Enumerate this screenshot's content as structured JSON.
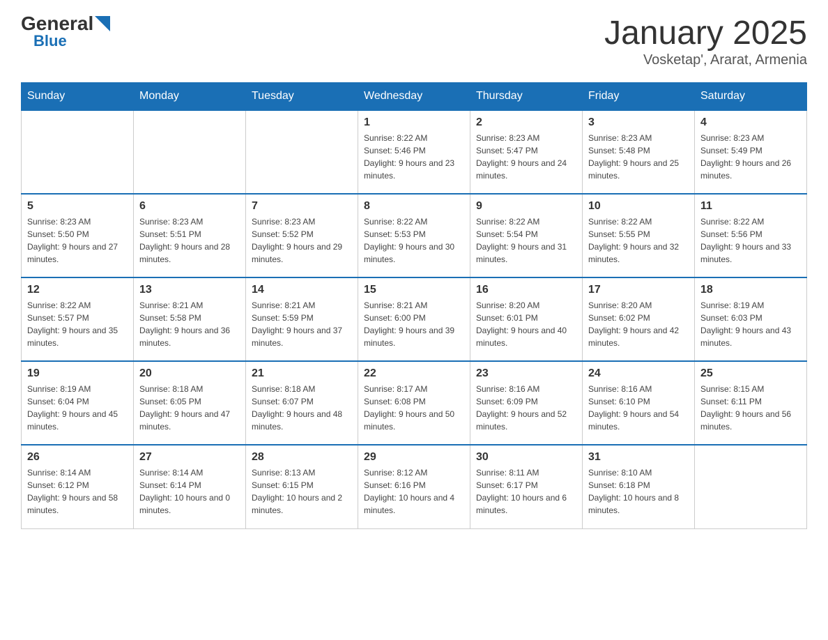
{
  "logo": {
    "general": "General",
    "blue": "Blue"
  },
  "title": "January 2025",
  "subtitle": "Vosketap', Ararat, Armenia",
  "days_of_week": [
    "Sunday",
    "Monday",
    "Tuesday",
    "Wednesday",
    "Thursday",
    "Friday",
    "Saturday"
  ],
  "weeks": [
    [
      {
        "day": "",
        "info": ""
      },
      {
        "day": "",
        "info": ""
      },
      {
        "day": "",
        "info": ""
      },
      {
        "day": "1",
        "info": "Sunrise: 8:22 AM\nSunset: 5:46 PM\nDaylight: 9 hours and 23 minutes."
      },
      {
        "day": "2",
        "info": "Sunrise: 8:23 AM\nSunset: 5:47 PM\nDaylight: 9 hours and 24 minutes."
      },
      {
        "day": "3",
        "info": "Sunrise: 8:23 AM\nSunset: 5:48 PM\nDaylight: 9 hours and 25 minutes."
      },
      {
        "day": "4",
        "info": "Sunrise: 8:23 AM\nSunset: 5:49 PM\nDaylight: 9 hours and 26 minutes."
      }
    ],
    [
      {
        "day": "5",
        "info": "Sunrise: 8:23 AM\nSunset: 5:50 PM\nDaylight: 9 hours and 27 minutes."
      },
      {
        "day": "6",
        "info": "Sunrise: 8:23 AM\nSunset: 5:51 PM\nDaylight: 9 hours and 28 minutes."
      },
      {
        "day": "7",
        "info": "Sunrise: 8:23 AM\nSunset: 5:52 PM\nDaylight: 9 hours and 29 minutes."
      },
      {
        "day": "8",
        "info": "Sunrise: 8:22 AM\nSunset: 5:53 PM\nDaylight: 9 hours and 30 minutes."
      },
      {
        "day": "9",
        "info": "Sunrise: 8:22 AM\nSunset: 5:54 PM\nDaylight: 9 hours and 31 minutes."
      },
      {
        "day": "10",
        "info": "Sunrise: 8:22 AM\nSunset: 5:55 PM\nDaylight: 9 hours and 32 minutes."
      },
      {
        "day": "11",
        "info": "Sunrise: 8:22 AM\nSunset: 5:56 PM\nDaylight: 9 hours and 33 minutes."
      }
    ],
    [
      {
        "day": "12",
        "info": "Sunrise: 8:22 AM\nSunset: 5:57 PM\nDaylight: 9 hours and 35 minutes."
      },
      {
        "day": "13",
        "info": "Sunrise: 8:21 AM\nSunset: 5:58 PM\nDaylight: 9 hours and 36 minutes."
      },
      {
        "day": "14",
        "info": "Sunrise: 8:21 AM\nSunset: 5:59 PM\nDaylight: 9 hours and 37 minutes."
      },
      {
        "day": "15",
        "info": "Sunrise: 8:21 AM\nSunset: 6:00 PM\nDaylight: 9 hours and 39 minutes."
      },
      {
        "day": "16",
        "info": "Sunrise: 8:20 AM\nSunset: 6:01 PM\nDaylight: 9 hours and 40 minutes."
      },
      {
        "day": "17",
        "info": "Sunrise: 8:20 AM\nSunset: 6:02 PM\nDaylight: 9 hours and 42 minutes."
      },
      {
        "day": "18",
        "info": "Sunrise: 8:19 AM\nSunset: 6:03 PM\nDaylight: 9 hours and 43 minutes."
      }
    ],
    [
      {
        "day": "19",
        "info": "Sunrise: 8:19 AM\nSunset: 6:04 PM\nDaylight: 9 hours and 45 minutes."
      },
      {
        "day": "20",
        "info": "Sunrise: 8:18 AM\nSunset: 6:05 PM\nDaylight: 9 hours and 47 minutes."
      },
      {
        "day": "21",
        "info": "Sunrise: 8:18 AM\nSunset: 6:07 PM\nDaylight: 9 hours and 48 minutes."
      },
      {
        "day": "22",
        "info": "Sunrise: 8:17 AM\nSunset: 6:08 PM\nDaylight: 9 hours and 50 minutes."
      },
      {
        "day": "23",
        "info": "Sunrise: 8:16 AM\nSunset: 6:09 PM\nDaylight: 9 hours and 52 minutes."
      },
      {
        "day": "24",
        "info": "Sunrise: 8:16 AM\nSunset: 6:10 PM\nDaylight: 9 hours and 54 minutes."
      },
      {
        "day": "25",
        "info": "Sunrise: 8:15 AM\nSunset: 6:11 PM\nDaylight: 9 hours and 56 minutes."
      }
    ],
    [
      {
        "day": "26",
        "info": "Sunrise: 8:14 AM\nSunset: 6:12 PM\nDaylight: 9 hours and 58 minutes."
      },
      {
        "day": "27",
        "info": "Sunrise: 8:14 AM\nSunset: 6:14 PM\nDaylight: 10 hours and 0 minutes."
      },
      {
        "day": "28",
        "info": "Sunrise: 8:13 AM\nSunset: 6:15 PM\nDaylight: 10 hours and 2 minutes."
      },
      {
        "day": "29",
        "info": "Sunrise: 8:12 AM\nSunset: 6:16 PM\nDaylight: 10 hours and 4 minutes."
      },
      {
        "day": "30",
        "info": "Sunrise: 8:11 AM\nSunset: 6:17 PM\nDaylight: 10 hours and 6 minutes."
      },
      {
        "day": "31",
        "info": "Sunrise: 8:10 AM\nSunset: 6:18 PM\nDaylight: 10 hours and 8 minutes."
      },
      {
        "day": "",
        "info": ""
      }
    ]
  ]
}
